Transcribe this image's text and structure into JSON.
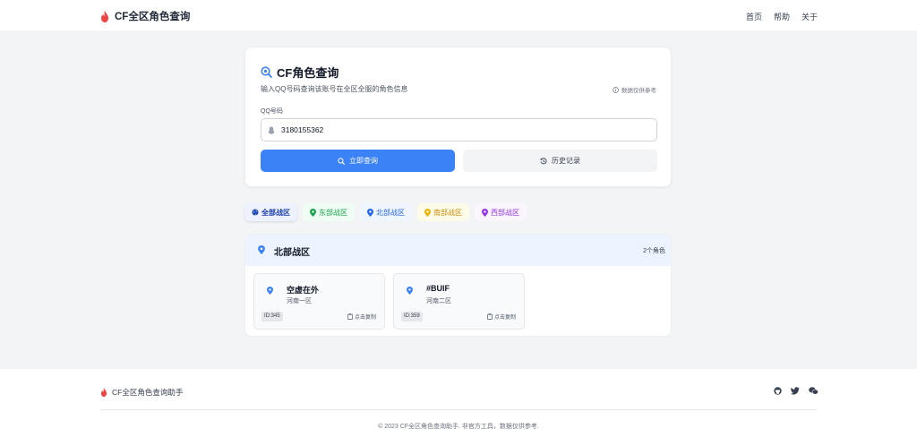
{
  "header": {
    "brand": "CF全区角色查询",
    "nav": [
      "首页",
      "帮助",
      "关于"
    ]
  },
  "search": {
    "title": "CF角色查询",
    "subtitle": "输入QQ号码查询该账号在全区全服的角色信息",
    "note": "数据仅供参考",
    "field_label": "QQ号码",
    "qq_value": "3180155362",
    "query_button": "立即查询",
    "history_button": "历史记录"
  },
  "tabs": [
    {
      "label": "全部战区",
      "color": "#1e40af"
    },
    {
      "label": "东部战区",
      "color": "#16a34a"
    },
    {
      "label": "北部战区",
      "color": "#2563eb"
    },
    {
      "label": "南部战区",
      "color": "#ca8a04"
    },
    {
      "label": "西部战区",
      "color": "#9333ea"
    }
  ],
  "results": {
    "zone": "北部战区",
    "count": "2个角色",
    "roles": [
      {
        "name": "空虚在外",
        "server": "河南一区",
        "id": "ID:345",
        "copy": "点击复制"
      },
      {
        "name": "#BUIF",
        "server": "河南二区",
        "id": "ID:359",
        "copy": "点击复制"
      }
    ]
  },
  "footer": {
    "brand": "CF全区角色查询助手",
    "icons": [
      "github-icon",
      "twitter-icon",
      "wechat-icon"
    ],
    "copyright": "© 2023 CF全区角色查询助手. 非官方工具，数据仅供参考."
  },
  "colors": {
    "primary": "#3b82f6",
    "brand_flame": "#ef4444"
  }
}
